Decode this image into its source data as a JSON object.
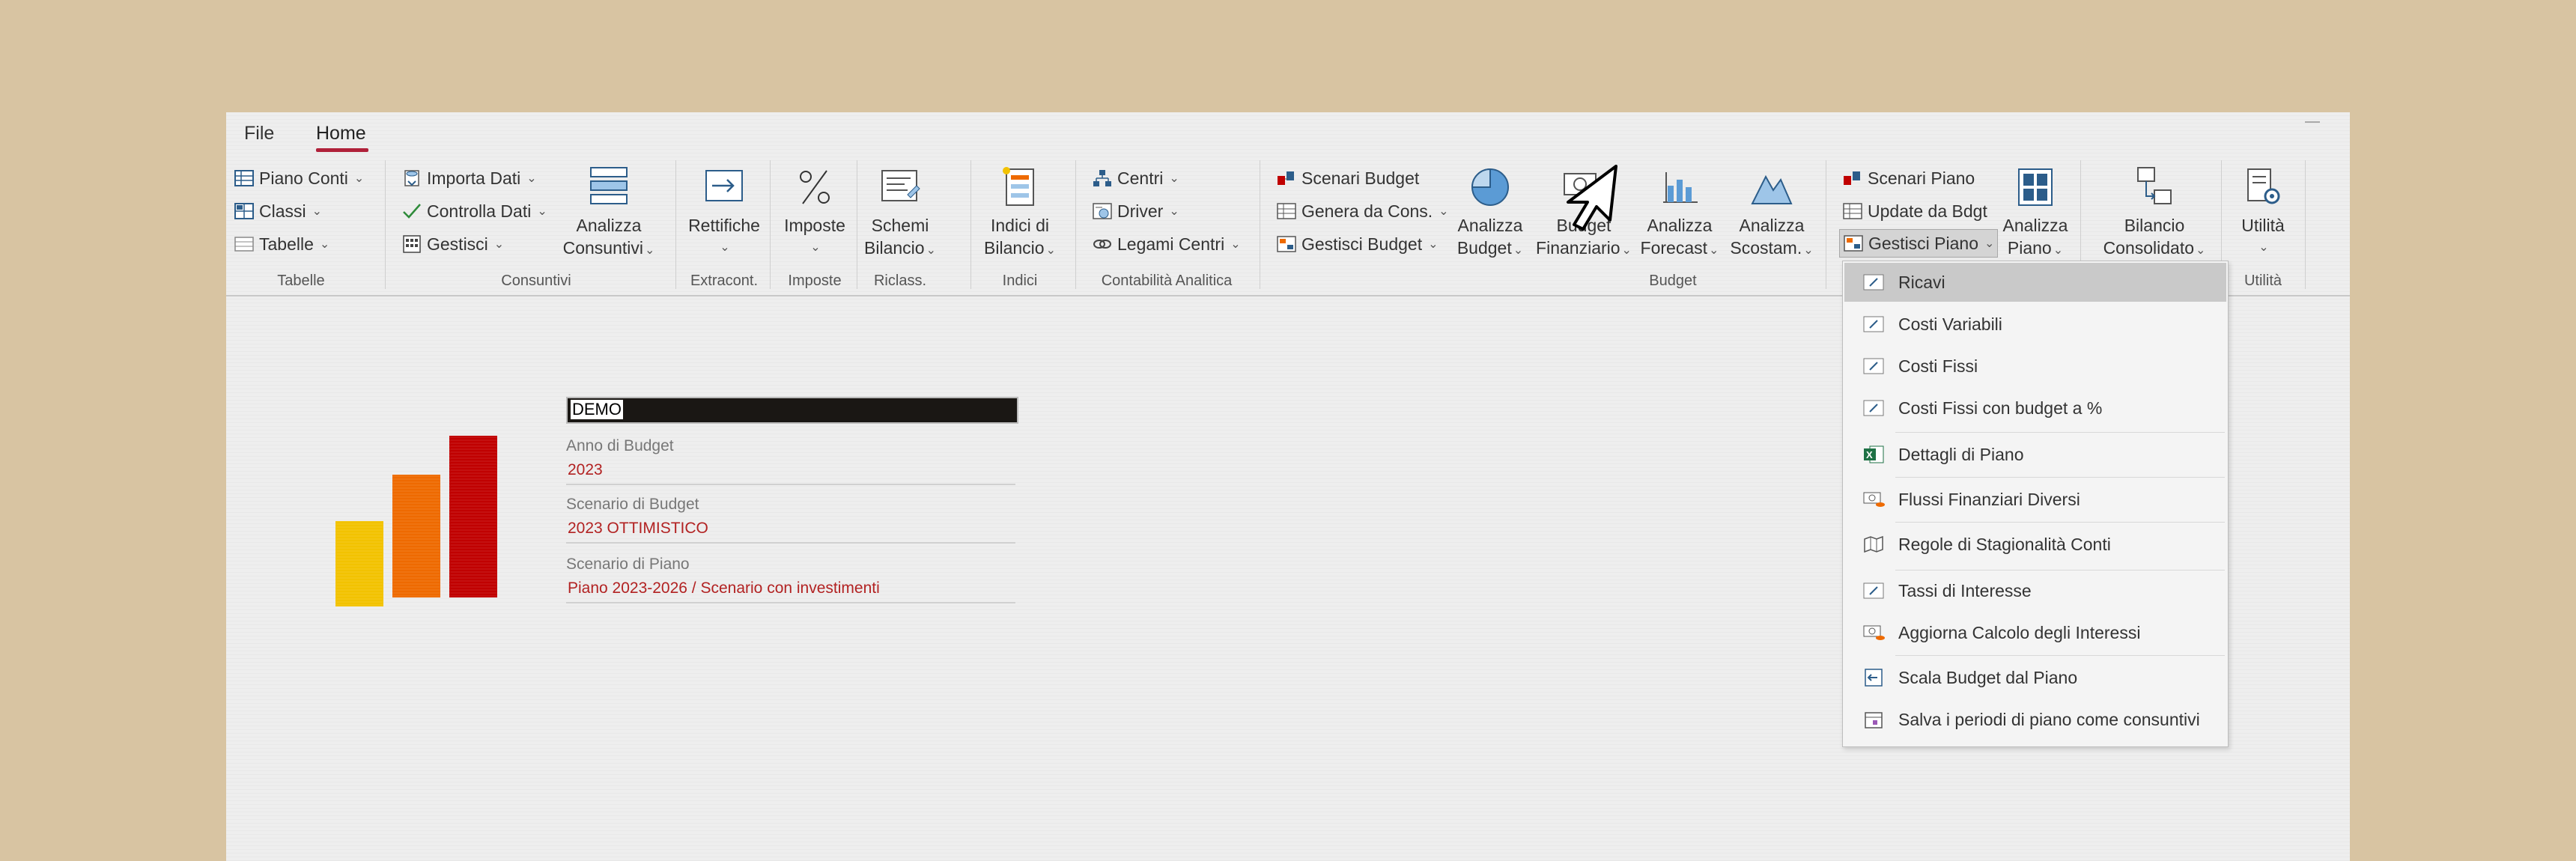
{
  "menu": {
    "file": "File",
    "home": "Home"
  },
  "ribbon": {
    "tabelle": {
      "piano_conti": "Piano Conti",
      "classi": "Classi",
      "tabelle": "Tabelle",
      "label": "Tabelle"
    },
    "consuntivi": {
      "importa": "Importa Dati",
      "controlla": "Controlla Dati",
      "gestisci": "Gestisci",
      "analizza1": "Analizza",
      "analizza2": "Consuntivi",
      "label": "Consuntivi"
    },
    "extracont": {
      "b1": "Rettifiche",
      "label": "Extracont."
    },
    "imposte": {
      "b1": "Imposte",
      "label": "Imposte"
    },
    "riclass": {
      "b1": "Schemi",
      "b2": "Bilancio",
      "label": "Riclass."
    },
    "indici": {
      "b1": "Indici di",
      "b2": "Bilancio",
      "label": "Indici"
    },
    "contabilita": {
      "centri": "Centri",
      "driver": "Driver",
      "legami": "Legami Centri",
      "label": "Contabilità Analitica"
    },
    "budget": {
      "scenari": "Scenari Budget",
      "genera": "Genera da Cons.",
      "gestisci": "Gestisci Budget",
      "ab1": "Analizza",
      "ab2": "Budget",
      "bf1": "Budget",
      "bf2": "Finanziario",
      "af1": "Analizza",
      "af2": "Forecast",
      "as1": "Analizza",
      "as2": "Scostam.",
      "scenari_piano": "Scenari Piano",
      "update": "Update da Bdgt",
      "gestisci_piano": "Gestisci Piano",
      "ap1": "Analizza",
      "ap2": "Piano",
      "label": "Budget"
    },
    "bilancio": {
      "b1": "Bilancio",
      "b2": "Consolidato"
    },
    "utilita": {
      "b1": "Utilità",
      "label": "Utilità"
    }
  },
  "content": {
    "company": "DEMO",
    "fields": [
      {
        "label": "Anno di Budget",
        "value": "2023"
      },
      {
        "label": "Scenario di Budget",
        "value": "2023 OTTIMISTICO"
      },
      {
        "label": "Scenario di Piano",
        "value": "Piano 2023-2026 / Scenario con investimenti"
      }
    ]
  },
  "dropdown": {
    "items": [
      {
        "label": "Ricavi",
        "icon": "form-icon"
      },
      {
        "label": "Costi Variabili",
        "icon": "form-icon"
      },
      {
        "label": "Costi Fissi",
        "icon": "form-icon"
      },
      {
        "label": "Costi Fissi con budget a %",
        "icon": "form-icon"
      },
      {
        "label": "Dettagli di Piano",
        "icon": "excel-icon"
      },
      {
        "label": "Flussi Finanziari Diversi",
        "icon": "money-icon"
      },
      {
        "label": "Regole di Stagionalità Conti",
        "icon": "map-icon"
      },
      {
        "label": "Tassi di Interesse",
        "icon": "form-icon"
      },
      {
        "label": "Aggiorna Calcolo degli Interessi",
        "icon": "money-icon"
      },
      {
        "label": "Scala Budget dal Piano",
        "icon": "arrow-left-icon"
      },
      {
        "label": "Salva i periodi di piano come consuntivi",
        "icon": "calendar-icon"
      }
    ]
  },
  "colors": {
    "accent": "#b0213a",
    "value_red": "#b22222",
    "bar_yellow": "#f2c200",
    "bar_orange": "#ee6a00",
    "bar_red": "#c00000"
  }
}
